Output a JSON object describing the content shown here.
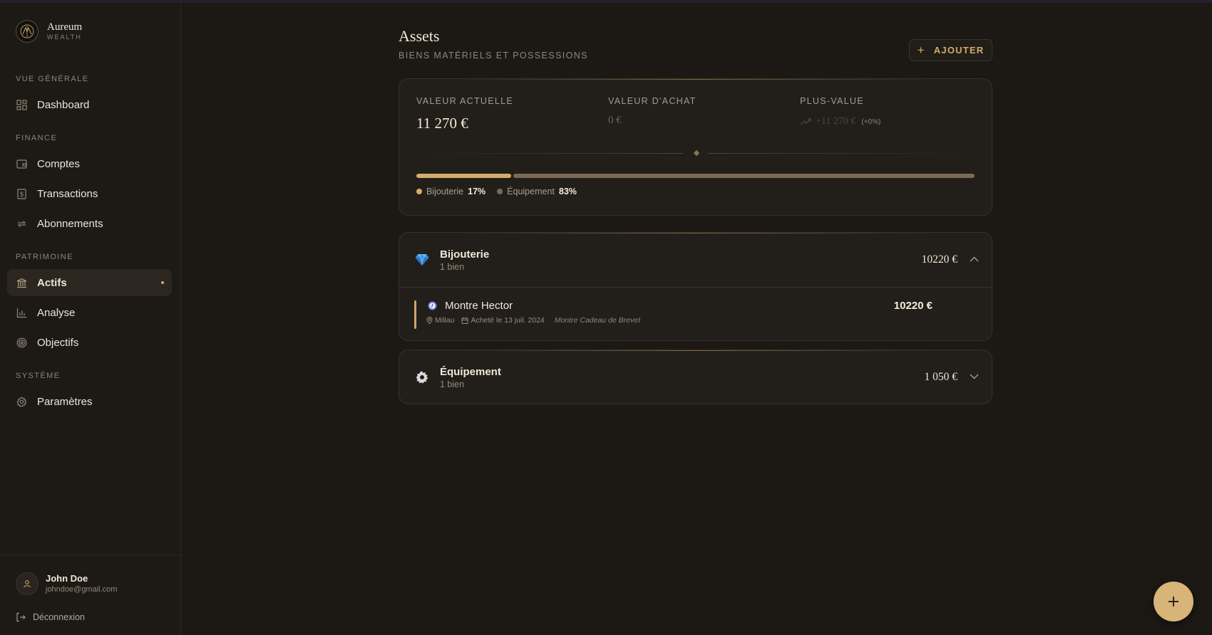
{
  "brand": {
    "name": "Aureum",
    "sub": "WEALTH"
  },
  "nav": {
    "sections": {
      "overview": "VUE GÉNÉRALE",
      "finance": "FINANCE",
      "patrimoine": "PATRIMOINE",
      "systeme": "SYSTÈME"
    },
    "items": {
      "dashboard": "Dashboard",
      "comptes": "Comptes",
      "transactions": "Transactions",
      "abonnements": "Abonnements",
      "actifs": "Actifs",
      "analyse": "Analyse",
      "objectifs": "Objectifs",
      "parametres": "Paramètres"
    },
    "active": "actifs"
  },
  "user": {
    "name": "John Doe",
    "email": "johndoe@gmail.com",
    "logout": "Déconnexion"
  },
  "header": {
    "title": "Assets",
    "subtitle": "BIENS MATÉRIELS ET POSSESSIONS",
    "add_label": "AJOUTER"
  },
  "summary": {
    "current_label": "VALEUR ACTUELLE",
    "current_value": "11 270 €",
    "purchase_label": "VALEUR D'ACHAT",
    "purchase_value": "0 €",
    "gain_label": "PLUS-VALUE",
    "gain_value": "+11 270 €",
    "gain_pct": "(+0%)",
    "distribution": [
      {
        "name": "Bijouterie",
        "pct_label": "17%",
        "fraction": 0.17,
        "color": "#d4ad6e"
      },
      {
        "name": "Équipement",
        "pct_label": "83%",
        "fraction": 0.83,
        "color": "#7a6a58"
      }
    ]
  },
  "categories": [
    {
      "name": "Bijouterie",
      "count": "1 bien",
      "total": "10220 €",
      "expanded": true,
      "icon": "gem-icon",
      "items": [
        {
          "name": "Montre Hector",
          "location": "Millau",
          "date": "Acheté le 13 juil. 2024",
          "note": "Montre Cadeau de Brevet",
          "value": "10220 €"
        }
      ]
    },
    {
      "name": "Équipement",
      "count": "1 bien",
      "total": "1 050 €",
      "expanded": false,
      "icon": "gear-icon"
    }
  ],
  "colors": {
    "accent": "#d4ab68",
    "background": "#1c1915",
    "card": "#221f1a"
  }
}
